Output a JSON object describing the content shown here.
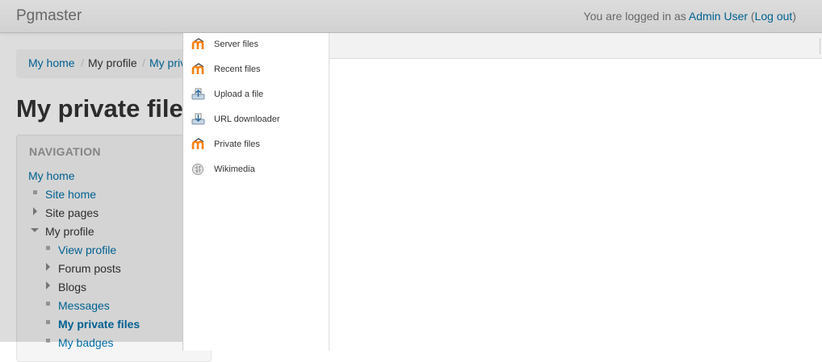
{
  "header": {
    "brand": "Pgmaster",
    "logged_in_prefix": "You are logged in as ",
    "user_name": "Admin User",
    "open_paren": " (",
    "logout": "Log out",
    "close_paren": ")"
  },
  "breadcrumb": {
    "items": [
      "My home",
      "My profile",
      "My priv"
    ],
    "separator": "/"
  },
  "page_title": "My private file",
  "navigation": {
    "header": "NAVIGATION",
    "items": [
      {
        "label": "My home"
      },
      {
        "label": "Site home"
      },
      {
        "label": "Site pages"
      },
      {
        "label": "My profile"
      },
      {
        "label": "View profile"
      },
      {
        "label": "Forum posts"
      },
      {
        "label": "Blogs"
      },
      {
        "label": "Messages"
      },
      {
        "label": "My private files"
      },
      {
        "label": "My badges"
      }
    ]
  },
  "file_picker": {
    "repositories": [
      {
        "label": "Server files",
        "icon": "moodle-icon"
      },
      {
        "label": "Recent files",
        "icon": "moodle-icon"
      },
      {
        "label": "Upload a file",
        "icon": "upload-icon"
      },
      {
        "label": "URL downloader",
        "icon": "download-icon"
      },
      {
        "label": "Private files",
        "icon": "moodle-icon"
      },
      {
        "label": "Wikimedia",
        "icon": "wikipedia-globe-icon"
      }
    ]
  },
  "colors": {
    "link": "#0070a8",
    "moodle_orange": "#f98012",
    "overlay": "rgba(0,0,0,0.135)"
  }
}
